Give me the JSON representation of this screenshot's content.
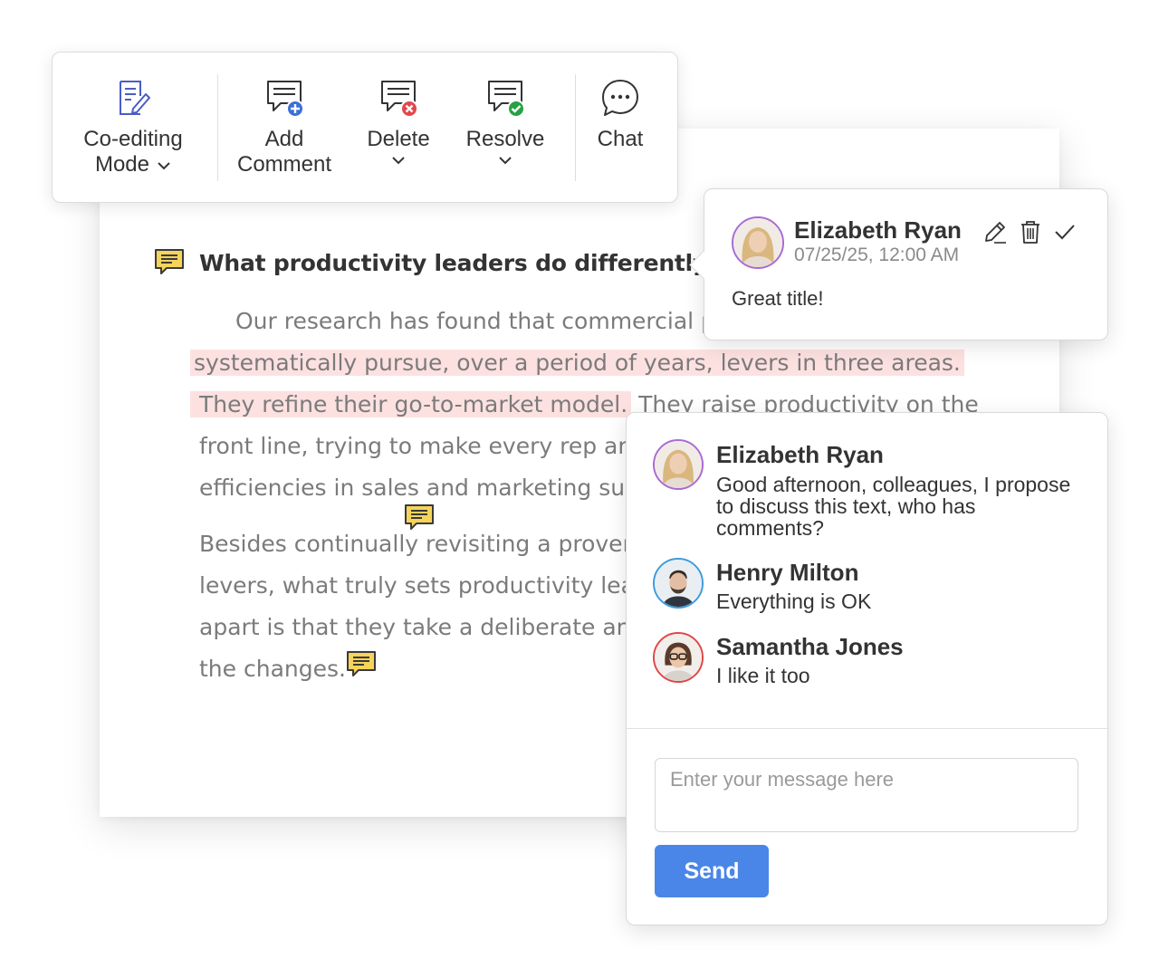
{
  "toolbar": {
    "coediting_label_1": "Co-editing",
    "coediting_label_2": "Mode",
    "add_comment_label_1": "Add",
    "add_comment_label_2": "Comment",
    "delete_label": "Delete",
    "resolve_label": "Resolve",
    "chat_label": "Chat"
  },
  "document": {
    "heading": "What productivity leaders do differently",
    "para1": [
      "Our research has found that commercial p",
      "systematically pursue, over a period of years, levers in three areas.",
      "They refine their go-to-market model.",
      " They raise productivity on the",
      "front line, trying to make every rep an A",
      "efficiencies in sales and marketing supp"
    ],
    "para2": [
      "Besides continually revisiting a proven",
      "levers, what truly sets productivity lead",
      "apart is that they take a deliberate and",
      "the changes."
    ]
  },
  "comment": {
    "author": "Elizabeth Ryan",
    "date": "07/25/25, 12:00 AM",
    "text": "Great title!"
  },
  "chat": {
    "messages": [
      {
        "author": "Elizabeth Ryan",
        "text": "Good afternoon, colleagues, I propose to discuss this text, who has comments?",
        "ring": "#a86ad3"
      },
      {
        "author": "Henry Milton",
        "text": "Everything is OK",
        "ring": "#3c9bdc"
      },
      {
        "author": "Samantha Jones",
        "text": "I like it too",
        "ring": "#e04646"
      }
    ],
    "input_placeholder": "Enter your message here",
    "send_label": "Send"
  },
  "colors": {
    "accent": "#4a86e8",
    "highlight": "#fde1e1",
    "comment_marker": "#f6d45a",
    "add_badge": "#3b6fd8",
    "delete_badge": "#e2474b",
    "resolve_badge": "#25a244"
  },
  "icons": [
    "edit-document-icon",
    "add-comment-icon",
    "delete-comment-icon",
    "resolve-comment-icon",
    "chat-bubble-icon",
    "comment-marker-icon",
    "pencil-icon",
    "trash-icon",
    "checkmark-icon"
  ]
}
